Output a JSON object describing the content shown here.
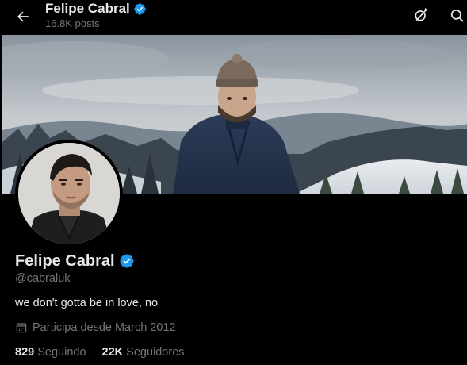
{
  "header": {
    "name": "Felipe Cabral",
    "posts_count": "16.8K posts",
    "icons": [
      "back-arrow-icon",
      "verified-badge-icon",
      "grok-icon",
      "search-icon"
    ]
  },
  "profile": {
    "display_name": "Felipe Cabral",
    "handle": "@cabraluk",
    "bio": "we don't gotta be in love, no",
    "joined": "Participa desde March 2012",
    "following_count": "829",
    "following_label": "Seguindo",
    "followers_count": "22K",
    "followers_label": "Seguidores"
  },
  "colors": {
    "background": "#000000",
    "text_primary": "#e7e9ea",
    "text_secondary": "#71767b",
    "verified": "#1d9bf0"
  }
}
